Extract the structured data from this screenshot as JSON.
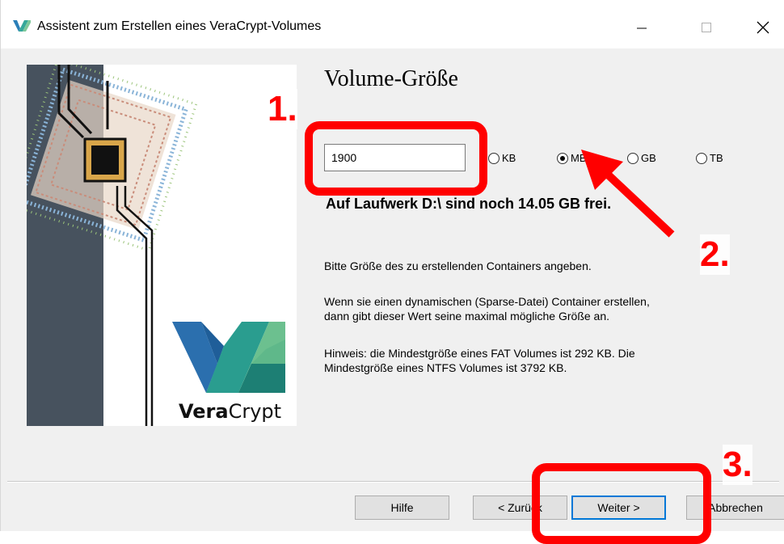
{
  "window": {
    "title": "Assistent zum Erstellen eines VeraCrypt-Volumes",
    "minimize_glyph": "—",
    "maximize_glyph": "☐",
    "close_glyph": "✕"
  },
  "banner": {
    "brand_bold": "Vera",
    "brand_regular": "Crypt"
  },
  "page": {
    "heading": "Volume-Größe",
    "size_value": "1900",
    "units": [
      {
        "label": "KB",
        "selected": false
      },
      {
        "label": "MB",
        "selected": true
      },
      {
        "label": "GB",
        "selected": false
      },
      {
        "label": "TB",
        "selected": false
      }
    ],
    "free_space": "Auf Laufwerk D:\\ sind noch 14.05 GB frei.",
    "instruction": "Bitte Größe des zu erstellenden Containers angeben.",
    "dynamic_line1": "Wenn sie einen dynamischen (Sparse-Datei) Container erstellen,",
    "dynamic_line2": "dann gibt dieser Wert seine maximal mögliche Größe an.",
    "hint_line1": "Hinweis: die Mindestgröße eines FAT Volumes ist 292 KB. Die",
    "hint_line2": "Mindestgröße eines NTFS Volumes ist 3792 KB."
  },
  "buttons": {
    "help": "Hilfe",
    "back": "< Zurück",
    "next": "Weiter >",
    "cancel": "Abbrechen"
  },
  "annotations": {
    "step1": "1.",
    "step2": "2.",
    "step3": "3.",
    "color": "#ff0000"
  }
}
